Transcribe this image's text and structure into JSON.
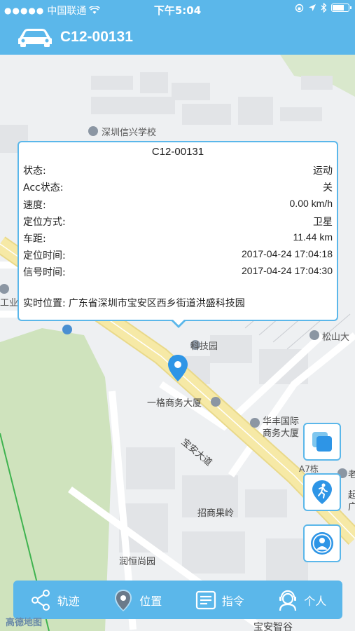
{
  "status_bar": {
    "carrier": "中国联通",
    "time": "下午5:04",
    "signal_dots": "●●●●●",
    "battery_level": 0.75
  },
  "header": {
    "title": "C12-00131"
  },
  "popup": {
    "title": "C12-00131",
    "rows": [
      {
        "label": "状态:",
        "value": "运动"
      },
      {
        "label": "Acc状态:",
        "value": "关"
      },
      {
        "label": "速度:",
        "value": "0.00 km/h"
      },
      {
        "label": "定位方式:",
        "value": "卫星"
      },
      {
        "label": "车距:",
        "value": "11.44 km"
      },
      {
        "label": "定位时间:",
        "value": "2017-04-24 17:04:18"
      },
      {
        "label": "信号时间:",
        "value": "2017-04-24 17:04:30"
      }
    ],
    "address_label": "实时位置:",
    "address": "广东省深圳市宝安区西乡街道洪盛科技园"
  },
  "map": {
    "labels": {
      "school": "深圳信兴学校",
      "industry": "工业",
      "tech_park": "科技园",
      "songshan": "松山大",
      "yige": "一格商务大厦",
      "huafeng_1": "华丰国际",
      "huafeng_2": "商务大厦",
      "baoan_road": "宝安大道",
      "a7": "A7栋",
      "zhaoshang": "招商果岭",
      "runheng": "润恒尚园",
      "baoan_zhigu": "宝安智谷",
      "logo": "高德地图",
      "edge_lao": "老",
      "edge_qi": "起",
      "edge_guang": "广"
    }
  },
  "tabs": [
    {
      "label": "轨迹",
      "icon": "share-icon"
    },
    {
      "label": "位置",
      "icon": "location-pin-icon"
    },
    {
      "label": "指令",
      "icon": "command-icon"
    },
    {
      "label": "个人",
      "icon": "user-icon"
    }
  ],
  "colors": {
    "primary": "#5bb7ea",
    "road_yellow": "#f6e9a6",
    "green_area": "#cfe3bd"
  }
}
